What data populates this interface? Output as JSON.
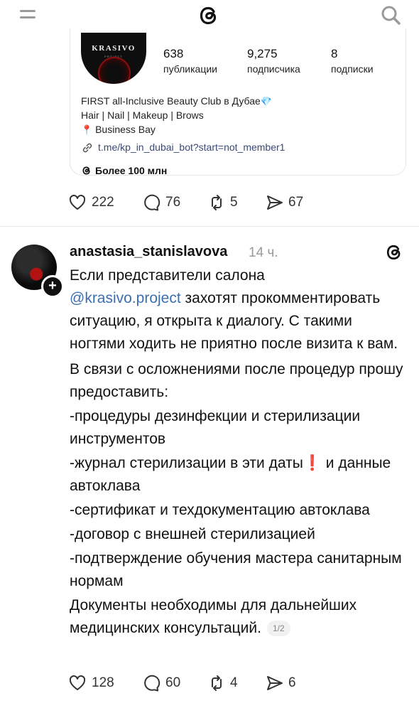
{
  "topbar": {
    "menu_icon": "hamburger-icon",
    "logo_icon": "threads-logo-icon",
    "search_icon": "search-icon"
  },
  "quoted_profile": {
    "brand_name": "KRASIVO",
    "brand_sub": "PROJECT",
    "stats": [
      {
        "value": "638",
        "label": "публикации"
      },
      {
        "value": "9,275",
        "label": "подписчика"
      },
      {
        "value": "8",
        "label": "подписки"
      }
    ],
    "bio_line1": "FIRST all-Inclusive Beauty Club в Дубае",
    "bio_line1_emoji": "💎",
    "bio_line2": "Hair | Nail | Makeup | Brows",
    "bio_line3_pin": "📍",
    "bio_line3": "Business Bay",
    "link": "t.me/kp_in_dubai_bot?start=not_member1",
    "followers_label": "Более 100 млн"
  },
  "post1_actions": {
    "likes": "222",
    "comments": "76",
    "reposts": "5",
    "shares": "67"
  },
  "post2": {
    "username": "anastasia_stanislavova",
    "time": "14 ч.",
    "plus": "+",
    "text": {
      "p1_a": "Если представители салона",
      "p1_mention": "@krasivo.project",
      "p1_b": " захотят прокомментировать ситуацию, я открыта к диалогу. С такими ногтями ходить не приятно после визита к вам.",
      "p2": "В связи с осложнениями после процедур прошу предоставить:",
      "p3": "-процедуры дезинфекции и стерилизации инструментов",
      "p4_a": "-журнал стерилизации в эти даты",
      "p4_excl": "❗",
      "p4_b": " и данные автоклава",
      "p5": "-сертификат и техдокументацию автоклава",
      "p6": "-договор с внешней стерилизацией",
      "p7": "-подтверждение обучения мастера санитарным нормам",
      "p8": "Документы необходимы для дальнейших медицинских консультаций.",
      "page": "1/2"
    },
    "actions": {
      "likes": "128",
      "comments": "60",
      "reposts": "4",
      "shares": "6"
    }
  }
}
